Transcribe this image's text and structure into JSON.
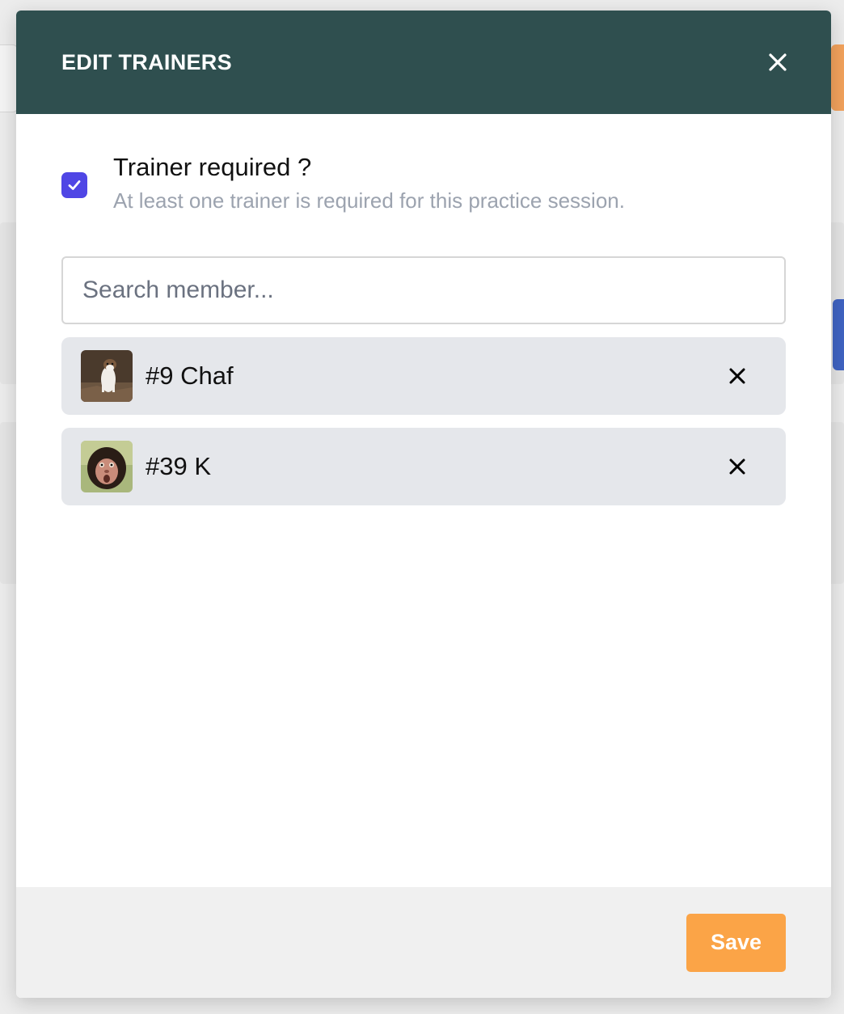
{
  "modal": {
    "title": "EDIT TRAINERS",
    "close_icon": "close-icon"
  },
  "required": {
    "checked": true,
    "label": "Trainer required ?",
    "help": "At least one trainer is required for this practice session."
  },
  "search": {
    "placeholder": "Search member...",
    "value": ""
  },
  "trainers": [
    {
      "name": "#9 Chaf",
      "avatar_icon": "weasel-avatar-icon",
      "remove_icon": "close-icon"
    },
    {
      "name": "#39 K",
      "avatar_icon": "monkey-avatar-icon",
      "remove_icon": "close-icon"
    }
  ],
  "footer": {
    "save_label": "Save"
  },
  "colors": {
    "header_bg": "#2f4f4f",
    "checkbox_accent": "#4f46e5",
    "trainer_item_bg": "#e5e7eb",
    "save_button": "#fba447",
    "footer_bg": "#f0f0f0",
    "help_text": "#9ca3af"
  }
}
